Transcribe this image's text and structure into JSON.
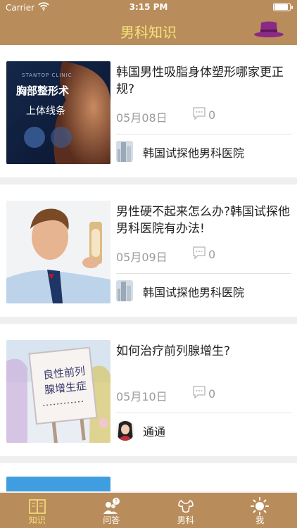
{
  "status_bar": {
    "carrier": "Carrier",
    "time": "3:15 PM"
  },
  "nav": {
    "title": "男科知识"
  },
  "articles": [
    {
      "title": "韩国男性吸脂身体塑形哪家更正规?",
      "date": "05月08日",
      "comments": "0",
      "author": "韩国试探他男科医院",
      "thumb_text": {
        "top": "STANTOP CLINIC",
        "main": "胸部整形术",
        "sub": "上体线条"
      }
    },
    {
      "title": "男性硬不起来怎么办?韩国试探他男科医院有办法!",
      "date": "05月09日",
      "comments": "0",
      "author": "韩国试探他男科医院"
    },
    {
      "title": "如何治疗前列腺增生?",
      "date": "05月10日",
      "comments": "0",
      "author": "通通",
      "thumb_text": {
        "line1": "良性前列",
        "line2": "腺增生症"
      }
    }
  ],
  "tabs": [
    {
      "label": "知识",
      "icon": "book-icon"
    },
    {
      "label": "问答",
      "icon": "qa-people-icon",
      "badge": "?"
    },
    {
      "label": "男科",
      "icon": "muscle-icon"
    },
    {
      "label": "我",
      "icon": "sun-icon"
    }
  ],
  "colors": {
    "brand": "#b98d5b",
    "title_text": "#f7e27a",
    "hat": "#8a2a84"
  }
}
